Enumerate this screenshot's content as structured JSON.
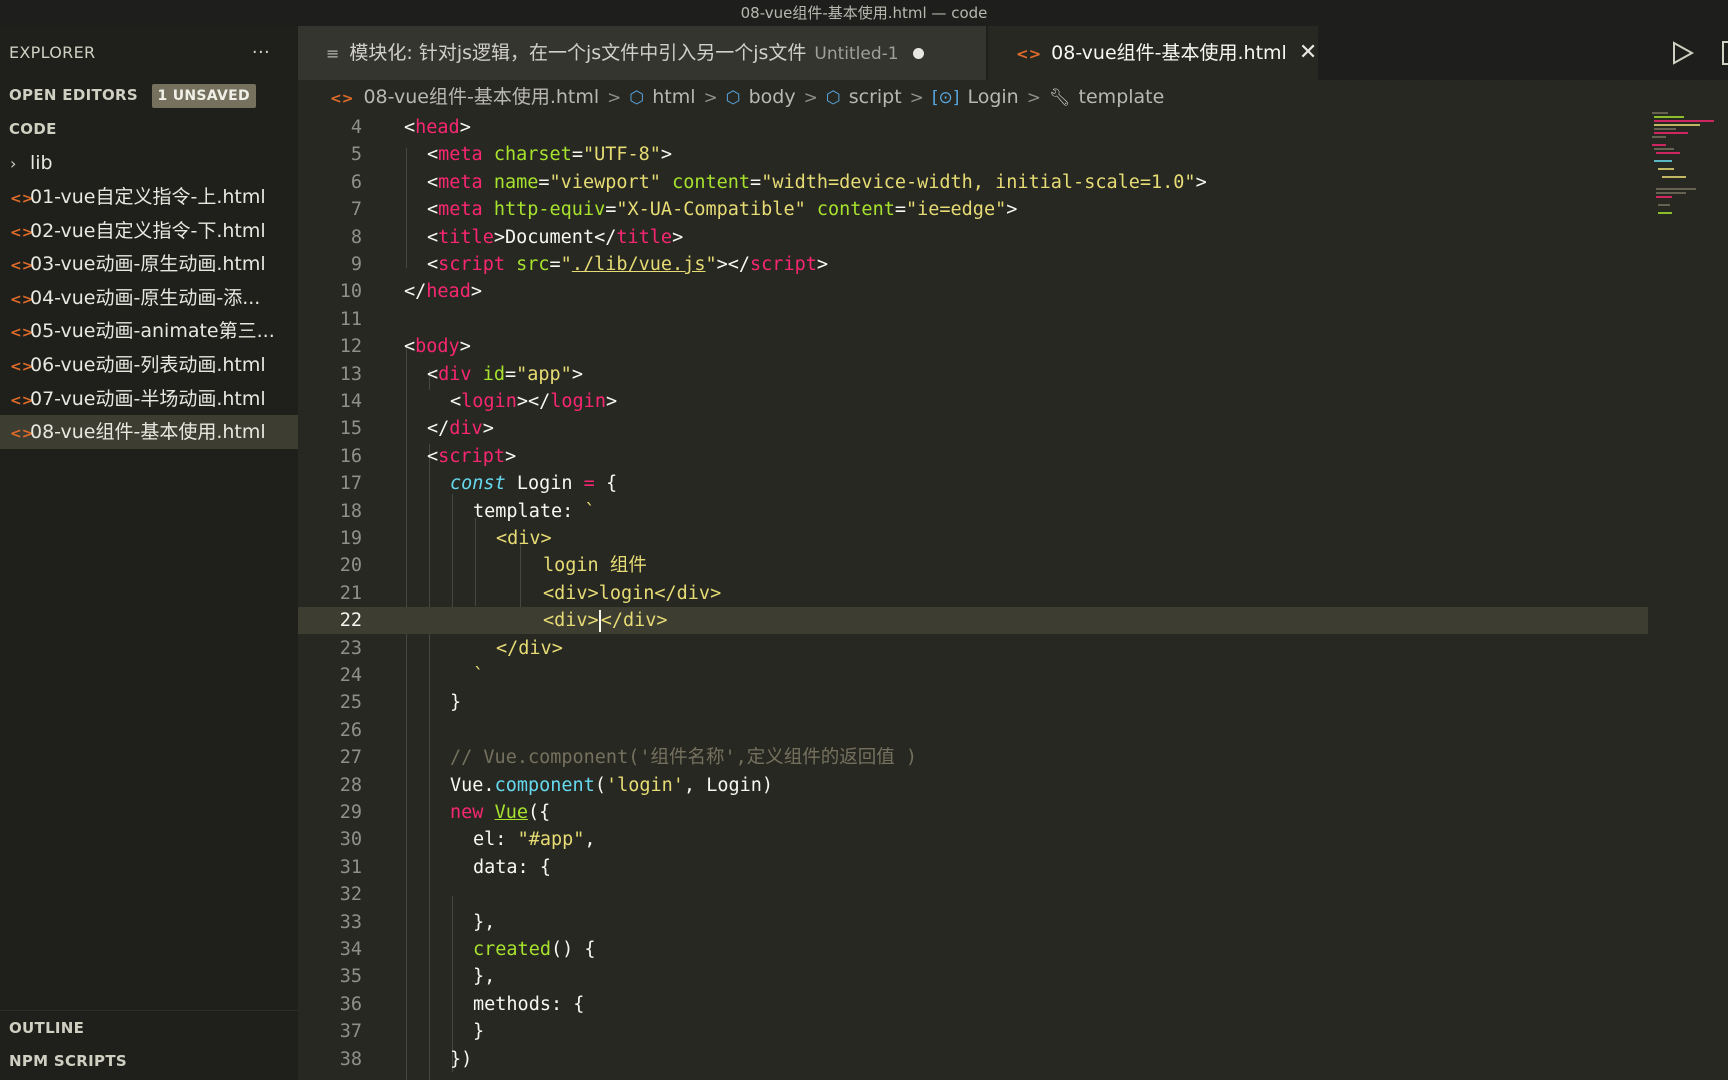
{
  "window": {
    "title": "08-vue组件-基本使用.html — code"
  },
  "sidebar": {
    "explorer_label": "EXPLORER",
    "more": "···",
    "open_editors": "OPEN EDITORS",
    "unsaved_badge": "1 UNSAVED",
    "folder": "CODE",
    "items": [
      {
        "label": "lib",
        "type": "folder"
      },
      {
        "label": "01-vue自定义指令-上.html",
        "type": "file"
      },
      {
        "label": "02-vue自定义指令-下.html",
        "type": "file"
      },
      {
        "label": "03-vue动画-原生动画.html",
        "type": "file"
      },
      {
        "label": "04-vue动画-原生动画-添...",
        "type": "file"
      },
      {
        "label": "05-vue动画-animate第三...",
        "type": "file"
      },
      {
        "label": "06-vue动画-列表动画.html",
        "type": "file"
      },
      {
        "label": "07-vue动画-半场动画.html",
        "type": "file"
      },
      {
        "label": "08-vue组件-基本使用.html",
        "type": "file",
        "active": true
      }
    ],
    "outline": "OUTLINE",
    "npm_scripts": "NPM SCRIPTS"
  },
  "tabs": [
    {
      "label": "模块化: 针对js逻辑，在一个js文件中引入另一个js文件",
      "suffix": "Untitled-1",
      "dirty": true
    },
    {
      "label": "08-vue组件-基本使用.html",
      "close": "✕",
      "active": true
    }
  ],
  "breadcrumb": [
    "08-vue组件-基本使用.html",
    "html",
    "body",
    "script",
    "Login",
    "template"
  ],
  "editor": {
    "line_numbers": [
      "4",
      "5",
      "6",
      "7",
      "8",
      "9",
      "10",
      "11",
      "12",
      "13",
      "14",
      "15",
      "16",
      "17",
      "18",
      "19",
      "20",
      "21",
      "22",
      "23",
      "24",
      "25",
      "26",
      "27",
      "28",
      "29",
      "30",
      "31",
      "32",
      "33",
      "34",
      "35",
      "36",
      "37",
      "38"
    ],
    "current_line": "22",
    "code": {
      "l4": [
        "<",
        "head",
        ">"
      ],
      "l5": [
        "<",
        "meta",
        " ",
        "charset",
        "=",
        "\"UTF-8\"",
        ">"
      ],
      "l6": [
        "<",
        "meta",
        " ",
        "name",
        "=",
        "\"viewport\"",
        " ",
        "content",
        "=",
        "\"width=device-width, initial-scale=1.0\"",
        ">"
      ],
      "l7": [
        "<",
        "meta",
        " ",
        "http-equiv",
        "=",
        "\"X-UA-Compatible\"",
        " ",
        "content",
        "=",
        "\"ie=edge\"",
        ">"
      ],
      "l8": [
        "<",
        "title",
        ">",
        "Document",
        "</",
        "title",
        ">"
      ],
      "l9": [
        "<",
        "script",
        " ",
        "src",
        "=",
        "\"",
        "./lib/vue.js",
        "\"",
        "></",
        "script",
        ">"
      ],
      "l10": [
        "</",
        "head",
        ">"
      ],
      "l12": [
        "<",
        "body",
        ">"
      ],
      "l13": [
        "<",
        "div",
        " ",
        "id",
        "=",
        "\"app\"",
        ">"
      ],
      "l14": [
        "<",
        "login",
        "></",
        "login",
        ">"
      ],
      "l15": [
        "</",
        "div",
        ">"
      ],
      "l16": [
        "<",
        "script",
        ">"
      ],
      "l17": [
        "const",
        " Login ",
        "=",
        " {"
      ],
      "l18": [
        "template: ",
        "`"
      ],
      "l19": [
        "<div>"
      ],
      "l20": [
        "login 组件"
      ],
      "l21": [
        "<div>login</div>"
      ],
      "l22a": [
        "<div>"
      ],
      "l22b": [
        "</div>"
      ],
      "l23": [
        "</div>"
      ],
      "l24": [
        "`"
      ],
      "l25": [
        "}"
      ],
      "l27": [
        "// Vue.component('组件名称',定义组件的返回值 )"
      ],
      "l28": [
        "Vue.",
        "component",
        "(",
        "'login'",
        ", Login)"
      ],
      "l29": [
        "new",
        " ",
        "Vue",
        "({"
      ],
      "l30": [
        "el: ",
        "\"#app\"",
        ","
      ],
      "l31": [
        "data: {"
      ],
      "l33": [
        "},"
      ],
      "l34": [
        "created",
        "() {"
      ],
      "l35": [
        "},"
      ],
      "l36": [
        "methods: {"
      ],
      "l37": [
        "}"
      ],
      "l38": [
        "})"
      ]
    }
  }
}
